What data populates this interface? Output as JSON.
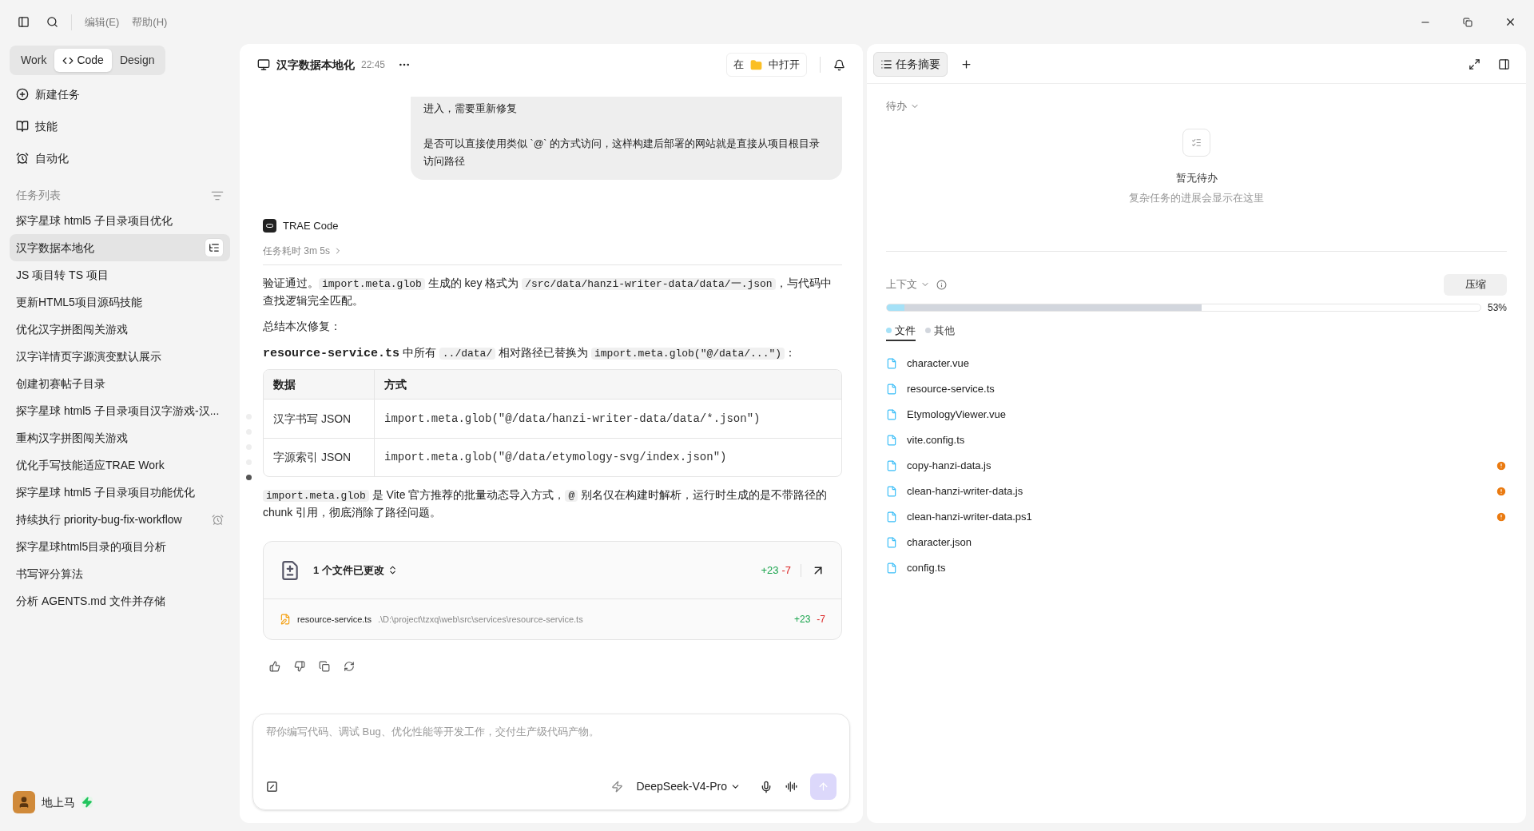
{
  "menu": [
    "编辑(E)",
    "帮助(H)"
  ],
  "mode_tabs": [
    {
      "label": "Work",
      "selected": false,
      "code_icon": false
    },
    {
      "label": "Code",
      "selected": true,
      "code_icon": true
    },
    {
      "label": "Design",
      "selected": false,
      "code_icon": false
    }
  ],
  "nav": [
    {
      "kind": "new",
      "label": "新建任务"
    },
    {
      "kind": "skills",
      "label": "技能"
    },
    {
      "kind": "automation",
      "label": "自动化"
    }
  ],
  "task_list": {
    "title": "任务列表",
    "items": [
      {
        "label": "探字星球 html5 子目录项目优化",
        "selected": false,
        "kind": "plain"
      },
      {
        "label": "汉字数据本地化",
        "selected": true,
        "kind": "plain"
      },
      {
        "label": "JS 项目转 TS 项目",
        "selected": false,
        "kind": "plain"
      },
      {
        "label": "更新HTML5项目源码技能",
        "selected": false,
        "kind": "plain"
      },
      {
        "label": "优化汉字拼图闯关游戏",
        "selected": false,
        "kind": "plain"
      },
      {
        "label": "汉字详情页字源演变默认展示",
        "selected": false,
        "kind": "plain"
      },
      {
        "label": "创建初赛帖子目录",
        "selected": false,
        "kind": "plain"
      },
      {
        "label": "探字星球 html5 子目录项目汉字游戏-汉...",
        "selected": false,
        "kind": "plain"
      },
      {
        "label": "重构汉字拼图闯关游戏",
        "selected": false,
        "kind": "plain"
      },
      {
        "label": "优化手写技能适应TRAE Work",
        "selected": false,
        "kind": "plain"
      },
      {
        "label": "探字星球 html5 子目录项目功能优化",
        "selected": false,
        "kind": "plain"
      },
      {
        "label": "持续执行 priority-bug-fix-workflow",
        "selected": false,
        "kind": "scheduled"
      },
      {
        "label": "探字星球html5目录的项目分析",
        "selected": false,
        "kind": "plain"
      },
      {
        "label": "书写评分算法",
        "selected": false,
        "kind": "plain"
      },
      {
        "label": "分析 AGENTS.md 文件并存储",
        "selected": false,
        "kind": "plain"
      }
    ]
  },
  "user": {
    "name": "地上马"
  },
  "chat": {
    "title": "汉字数据本地化",
    "time": "22:45",
    "open_in": [
      "在",
      "中打开"
    ],
    "user_message": [
      "进入，需要重新修复",
      "是否可以直接使用类似 `@` 的方式访问，这样构建后部署的网站就是直接从项目根目录访问路径"
    ],
    "agent": "TRAE Code",
    "duration": "任务耗时 3m 5s",
    "paragraphs": [
      [
        {
          "text": "验证通过。",
          "kind": "text"
        },
        {
          "text": "import.meta.glob",
          "kind": "code"
        },
        {
          "text": " 生成的 key 格式为 ",
          "kind": "text"
        },
        {
          "text": "/src/data/hanzi-writer-data/data/一.json",
          "kind": "code"
        },
        {
          "text": "，与代码中查找逻辑完全匹配。",
          "kind": "text"
        }
      ],
      [
        {
          "text": "总结本次修复：",
          "kind": "text"
        }
      ],
      [
        {
          "text": "resource-service.ts",
          "kind": "strong"
        },
        {
          "text": " 中所有 ",
          "kind": "text"
        },
        {
          "text": "../data/",
          "kind": "code"
        },
        {
          "text": " 相对路径已替换为 ",
          "kind": "text"
        },
        {
          "text": "import.meta.glob(\"@/data/...\")",
          "kind": "code"
        },
        {
          "text": "：",
          "kind": "text"
        }
      ]
    ],
    "table": {
      "columns": [
        "数据",
        "方式"
      ],
      "rows": [
        [
          "汉字书写 JSON",
          "import.meta.glob(\"@/data/hanzi-writer-data/data/*.json\")"
        ],
        [
          "字源索引 JSON",
          "import.meta.glob(\"@/data/etymology-svg/index.json\")"
        ]
      ]
    },
    "closing": [
      {
        "text": "import.meta.glob",
        "kind": "code"
      },
      {
        "text": " 是 Vite 官方推荐的批量动态导入方式，",
        "kind": "text"
      },
      {
        "text": "@",
        "kind": "code"
      },
      {
        "text": " 别名仅在构建时解析，运行时生成的是不带路径的 chunk 引用，彻底消除了路径问题。",
        "kind": "text"
      }
    ],
    "changes": {
      "title": "1 个文件已更改",
      "added": "+23",
      "removed": "-7",
      "files": [
        {
          "name": "resource-service.ts",
          "path": ".\\D:\\project\\tzxq\\web\\src\\services\\resource-service.ts",
          "added": "+23",
          "removed": "-7"
        }
      ]
    },
    "scroll_markers": [
      {
        "selected": false
      },
      {
        "selected": false
      },
      {
        "selected": false
      },
      {
        "selected": false
      },
      {
        "selected": true
      }
    ],
    "input": {
      "placeholder": "帮你编写代码、调试 Bug、优化性能等开发工作，交付生产级代码产物。",
      "model": "DeepSeek-V4-Pro"
    }
  },
  "side": {
    "tabs": [
      {
        "label": "任务摘要",
        "selected": true
      }
    ],
    "todo": {
      "title": "待办",
      "empty_title": "暂无待办",
      "empty_hint": "复杂任务的进展会显示在这里"
    },
    "context": {
      "title": "上下文",
      "compress": "压缩",
      "reading": "53%",
      "segments": [
        {
          "level": 0.53,
          "color": "#d2d6dd"
        },
        {
          "level": 0.03,
          "color": "#a5e1f7"
        }
      ],
      "legend": [
        {
          "label": "文件",
          "selected": true,
          "color": "#a5e1f7"
        },
        {
          "label": "其他",
          "selected": false,
          "color": "#d2d6dd"
        }
      ],
      "files": [
        {
          "name": "character.vue",
          "warning": false
        },
        {
          "name": "resource-service.ts",
          "warning": false
        },
        {
          "name": "EtymologyViewer.vue",
          "warning": false
        },
        {
          "name": "vite.config.ts",
          "warning": false
        },
        {
          "name": "copy-hanzi-data.js",
          "warning": true
        },
        {
          "name": "clean-hanzi-writer-data.js",
          "warning": true
        },
        {
          "name": "clean-hanzi-writer-data.ps1",
          "warning": true
        },
        {
          "name": "character.json",
          "warning": false
        },
        {
          "name": "config.ts",
          "warning": false
        }
      ]
    }
  }
}
